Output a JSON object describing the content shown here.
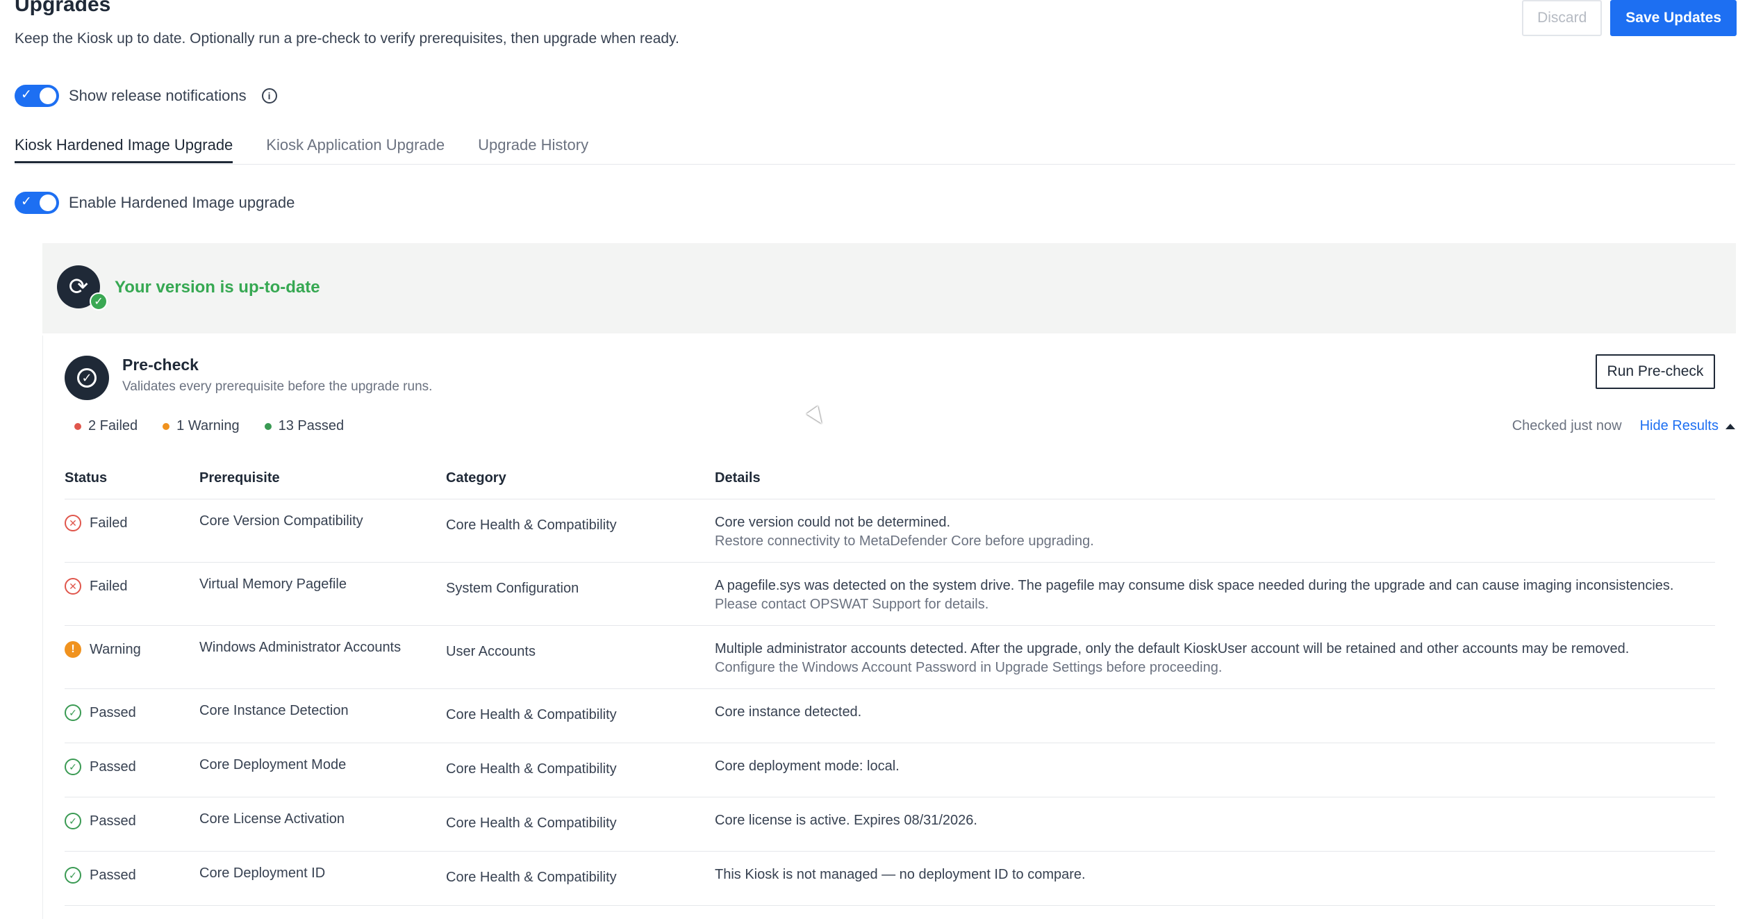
{
  "header": {
    "title": "Upgrades",
    "subtitle": "Keep the Kiosk up to date. Optionally run a pre-check to verify prerequisites, then upgrade when ready.",
    "discard_label": "Discard",
    "save_label": "Save Updates"
  },
  "notifications": {
    "label": "Show release notifications",
    "enabled": true
  },
  "tabs": [
    {
      "label": "Kiosk Hardened Image Upgrade",
      "active": true
    },
    {
      "label": "Kiosk Application Upgrade",
      "active": false
    },
    {
      "label": "Upgrade History",
      "active": false
    }
  ],
  "hardened": {
    "toggle_label": "Enable Hardened Image upgrade",
    "enabled": true,
    "version_status": "Your version is up-to-date"
  },
  "precheck": {
    "title": "Pre-check",
    "subtitle": "Validates every prerequisite before the upgrade runs.",
    "run_label": "Run Pre-check",
    "summary": {
      "failed": "2 Failed",
      "warning": "1 Warning",
      "passed": "13 Passed"
    },
    "checked_text": "Checked just now",
    "hide_results_label": "Hide Results",
    "columns": {
      "status": "Status",
      "prerequisite": "Prerequisite",
      "category": "Category",
      "details": "Details"
    },
    "rows": [
      {
        "status": "Failed",
        "prerequisite": "Core Version Compatibility",
        "category": "Core Health & Compatibility",
        "details": "Core version could not be determined.",
        "details_sub": "Restore connectivity to MetaDefender Core before upgrading."
      },
      {
        "status": "Failed",
        "prerequisite": "Virtual Memory Pagefile",
        "category": "System Configuration",
        "details": "A pagefile.sys was detected on the system drive. The pagefile may consume disk space needed during the upgrade and can cause imaging inconsistencies.",
        "details_sub": "Please contact OPSWAT Support for details."
      },
      {
        "status": "Warning",
        "prerequisite": "Windows Administrator Accounts",
        "category": "User Accounts",
        "details": "Multiple administrator accounts detected. After the upgrade, only the default KioskUser account will be retained and other accounts may be removed.",
        "details_sub": "Configure the Windows Account Password in Upgrade Settings before proceeding."
      },
      {
        "status": "Passed",
        "prerequisite": "Core Instance Detection",
        "category": "Core Health & Compatibility",
        "details": "Core instance detected.",
        "details_sub": ""
      },
      {
        "status": "Passed",
        "prerequisite": "Core Deployment Mode",
        "category": "Core Health & Compatibility",
        "details": "Core deployment mode: local.",
        "details_sub": ""
      },
      {
        "status": "Passed",
        "prerequisite": "Core License Activation",
        "category": "Core Health & Compatibility",
        "details": "Core license is active. Expires 08/31/2026.",
        "details_sub": ""
      },
      {
        "status": "Passed",
        "prerequisite": "Core Deployment ID",
        "category": "Core Health & Compatibility",
        "details": "This Kiosk is not managed — no deployment ID to compare.",
        "details_sub": ""
      }
    ]
  },
  "colors": {
    "primary": "#1d6ff2",
    "success": "#36a852",
    "failed": "#e0564c",
    "warning": "#f0921e",
    "dark": "#1f2937"
  }
}
